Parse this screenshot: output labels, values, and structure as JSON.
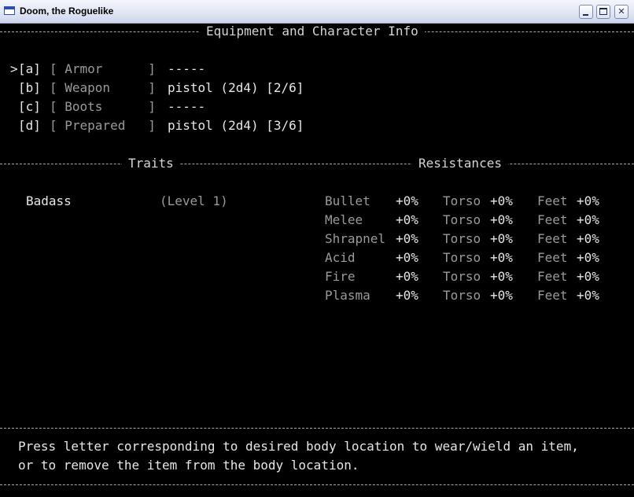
{
  "window": {
    "title": "Doom, the Roguelike",
    "buttons": {
      "minimize": "",
      "maximize": "",
      "close": "✕"
    }
  },
  "header": {
    "equipment_title": "Equipment and Character Info",
    "traits_title": "Traits",
    "resistances_title": "Resistances"
  },
  "equipment": [
    {
      "cursor": ">",
      "key": "[a]",
      "slot": "[ Armor      ]",
      "item": "-----"
    },
    {
      "cursor": "",
      "key": "[b]",
      "slot": "[ Weapon     ]",
      "item": "pistol (2d4) [2/6]"
    },
    {
      "cursor": "",
      "key": "[c]",
      "slot": "[ Boots      ]",
      "item": "-----"
    },
    {
      "cursor": "",
      "key": "[d]",
      "slot": "[ Prepared   ]",
      "item": "pistol (2d4) [3/6]"
    }
  ],
  "traits": [
    {
      "name": "Badass",
      "level": "(Level 1)"
    }
  ],
  "resistances": [
    {
      "type": "Bullet",
      "base": "+0%",
      "torso_label": "Torso",
      "torso": "+0%",
      "feet_label": "Feet",
      "feet": "+0%"
    },
    {
      "type": "Melee",
      "base": "+0%",
      "torso_label": "Torso",
      "torso": "+0%",
      "feet_label": "Feet",
      "feet": "+0%"
    },
    {
      "type": "Shrapnel",
      "base": "+0%",
      "torso_label": "Torso",
      "torso": "+0%",
      "feet_label": "Feet",
      "feet": "+0%"
    },
    {
      "type": "Acid",
      "base": "+0%",
      "torso_label": "Torso",
      "torso": "+0%",
      "feet_label": "Feet",
      "feet": "+0%"
    },
    {
      "type": "Fire",
      "base": "+0%",
      "torso_label": "Torso",
      "torso": "+0%",
      "feet_label": "Feet",
      "feet": "+0%"
    },
    {
      "type": "Plasma",
      "base": "+0%",
      "torso_label": "Torso",
      "torso": "+0%",
      "feet_label": "Feet",
      "feet": "+0%"
    }
  ],
  "footer": {
    "line1": "Press letter corresponding to desired body location to wear/wield an item,",
    "line2": "or to remove the item from the body location."
  }
}
